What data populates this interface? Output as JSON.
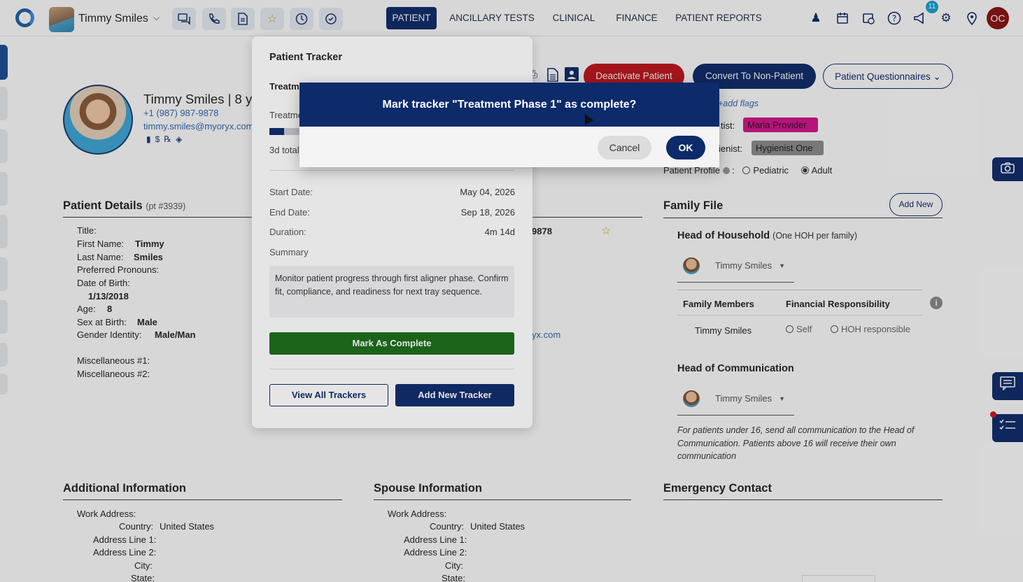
{
  "topbar": {
    "user_name": "Timmy Smiles",
    "nav": [
      "PATIENT",
      "ANCILLARY TESTS",
      "CLINICAL",
      "FINANCE",
      "PATIENT REPORTS"
    ],
    "notification_count": "11",
    "user_initials": "OC"
  },
  "patient": {
    "header": "Timmy Smiles | 8 yea",
    "phone": "+1 (987) 987-9878",
    "email": "timmy.smiles@myoryx.com"
  },
  "actions": {
    "deactivate": "Deactivate Patient",
    "convert": "Convert To Non-Patient",
    "questionnaires": "Patient Questionnaires"
  },
  "flags": {
    "add_flags": "+add flags",
    "dentist_label": "tist:",
    "dentist_value": "Maria Provider",
    "hygienist_label": "ienist:",
    "hygienist_value": "Hygienist One",
    "profile_label": "Patient Profile",
    "profile_options": [
      "Pediatric",
      "Adult"
    ]
  },
  "details": {
    "title": "Patient Details",
    "pt_no": "(pt #3939)",
    "title_label": "Title:",
    "first_label": "First Name:",
    "first_value": "Timmy",
    "last_label": "Last Name:",
    "last_value": "Smiles",
    "pronouns_label": "Preferred Pronouns:",
    "dob_label": "Date of Birth:",
    "dob_value": "1/13/2018",
    "age_label": "Age:",
    "age_value": "8",
    "sex_label": "Sex at Birth:",
    "sex_value": "Male",
    "gender_label": "Gender Identity:",
    "gender_value": "Male/Man",
    "misc1_label": "Miscellaneous #1:",
    "misc2_label": "Miscellaneous #2:"
  },
  "contact_partial": {
    "phone_tail": "9878",
    "email_tail": "yx.com"
  },
  "family": {
    "title": "Family File",
    "add_new": "Add New",
    "hoh_title": "Head of Household",
    "hoh_note": "(One HOH per family)",
    "hoh_name": "Timmy Smiles",
    "members_header": "Family Members",
    "resp_header": "Financial Responsibility",
    "member_name": "Timmy Smiles",
    "resp_self": "Self",
    "resp_hoh": "HOH responsible",
    "hoc_title": "Head of Communication",
    "hoc_name": "Timmy Smiles",
    "hoc_note": "For patients under 16, send all communication to the Head of Communication. Patients above 16 will receive their own communication"
  },
  "additional": {
    "title": "Additional Information",
    "work_label": "Work Address:",
    "country_label": "Country:",
    "country_value": "United States",
    "addr1_label": "Address Line 1:",
    "addr2_label": "Address Line 2:",
    "city_label": "City:",
    "state_label": "State:"
  },
  "spouse": {
    "title": "Spouse Information",
    "work_label": "Work Address:",
    "country_label": "Country:",
    "country_value": "United States",
    "addr1_label": "Address Line 1:",
    "addr2_label": "Address Line 2:",
    "city_label": "City:",
    "state_label": "State:"
  },
  "emergency": {
    "title": "Emergency Contact"
  },
  "tracker": {
    "title": "Patient Tracker",
    "name_partial": "Treatme",
    "sub_partial": "Treatme",
    "total_partial": "3d total",
    "progress": 0.06,
    "start_label": "Start Date:",
    "start_value": "May 04, 2026",
    "end_label": "End Date:",
    "end_value": "Sep 18, 2026",
    "duration_label": "Duration:",
    "duration_value": "4m 14d",
    "summary_label": "Summary",
    "summary_text": "Monitor patient progress through first aligner phase. Confirm fit, compliance, and readiness for next tray sequence.",
    "mark_complete": "Mark As Complete",
    "view_all": "View All Trackers",
    "add_new": "Add New Tracker"
  },
  "confirm": {
    "message": "Mark tracker \"Treatment Phase 1\" as complete?",
    "cancel": "Cancel",
    "ok": "OK"
  },
  "colors": {
    "navy": "#0d2a6b",
    "danger": "#c0151c",
    "success": "#1a6b16",
    "link": "#2f67b0",
    "dentist_tag": "#d4158c"
  }
}
